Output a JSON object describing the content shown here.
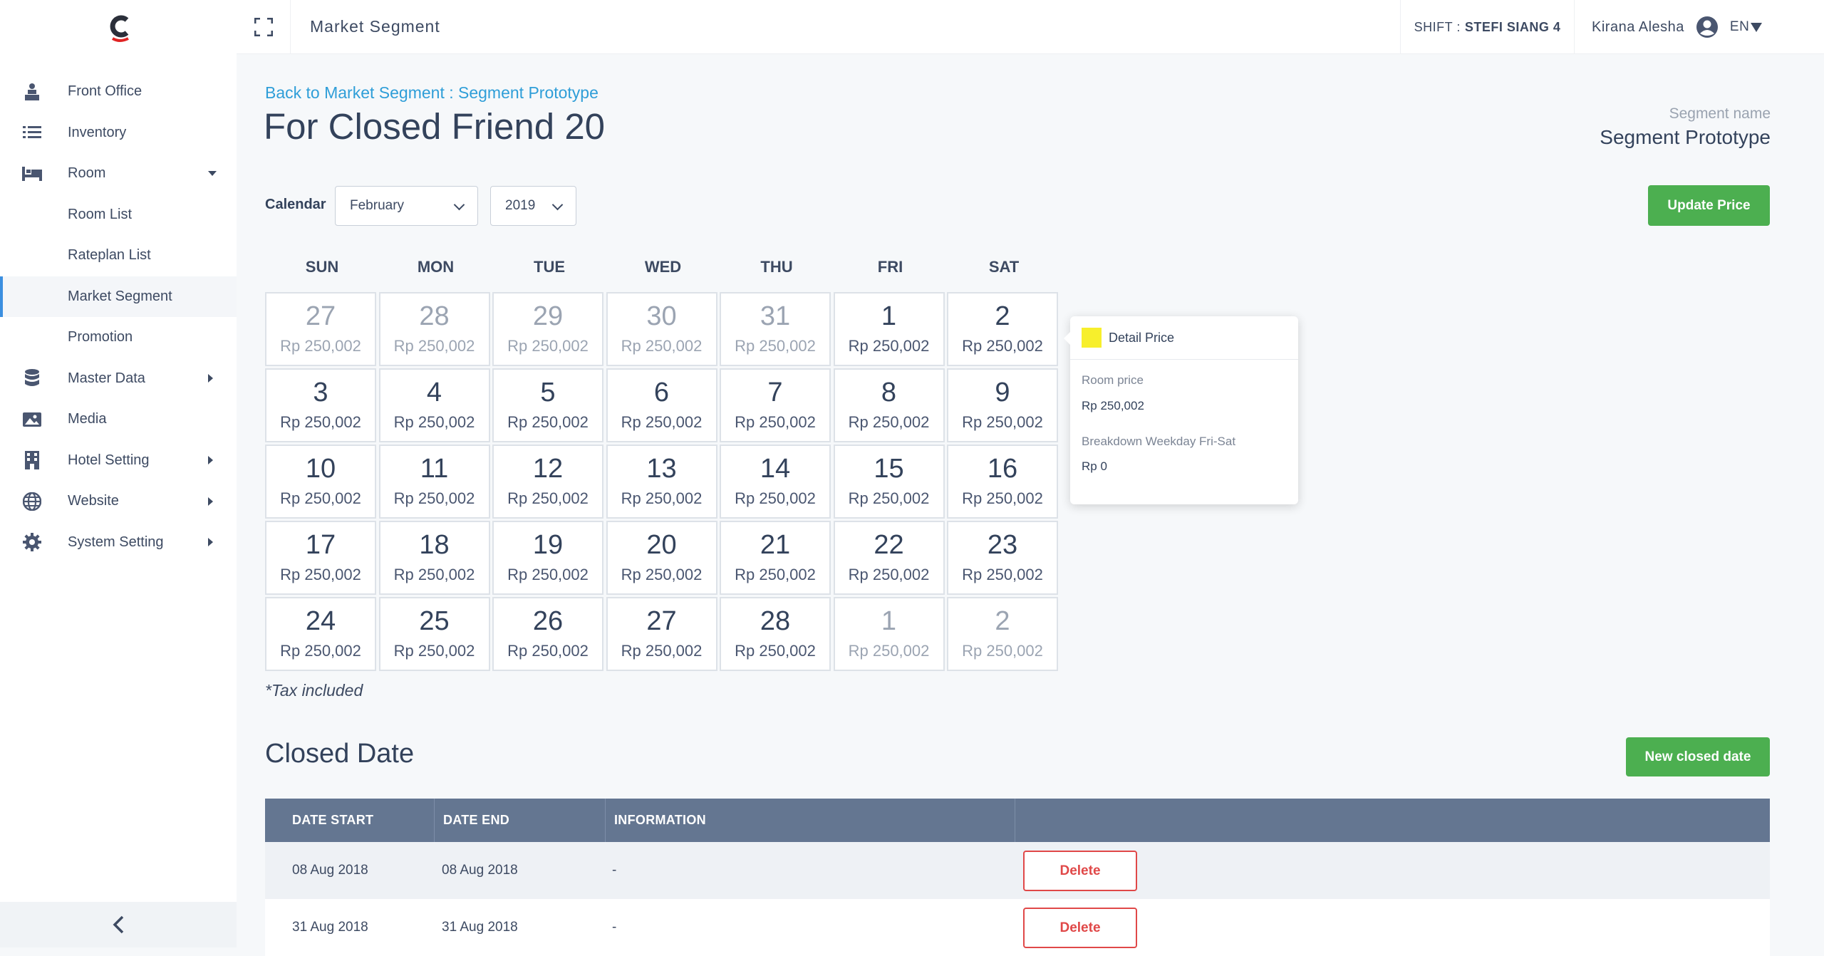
{
  "header": {
    "title": "Market Segment",
    "shift_label": "SHIFT :",
    "shift_name": "STEFI SIANG 4",
    "user_name": "Kirana Alesha",
    "language": "EN"
  },
  "sidebar": {
    "items": [
      {
        "label": "Front Office",
        "icon": "front-office-icon"
      },
      {
        "label": "Inventory",
        "icon": "list-icon"
      },
      {
        "label": "Room",
        "icon": "bed-icon",
        "expanded": true
      },
      {
        "label": "Room List"
      },
      {
        "label": "Rateplan List"
      },
      {
        "label": "Market Segment",
        "active": true
      },
      {
        "label": "Promotion"
      },
      {
        "label": "Master Data",
        "icon": "database-icon"
      },
      {
        "label": "Media",
        "icon": "image-icon"
      },
      {
        "label": "Hotel Setting",
        "icon": "building-icon"
      },
      {
        "label": "Website",
        "icon": "globe-icon"
      },
      {
        "label": "System Setting",
        "icon": "gear-icon"
      }
    ]
  },
  "page": {
    "back_link": "Back to Market Segment : Segment Prototype",
    "title": "For Closed Friend 20",
    "segment_name_label": "Segment name",
    "segment_name_value": "Segment Prototype",
    "update_button": "Update Price",
    "calendar_label": "Calendar",
    "month": "February",
    "year": "2019",
    "tax_note": "*Tax included"
  },
  "calendar": {
    "days": [
      "SUN",
      "MON",
      "TUE",
      "WED",
      "THU",
      "FRI",
      "SAT"
    ],
    "weeks": [
      [
        {
          "d": "27",
          "p": "Rp 250,002",
          "m": true
        },
        {
          "d": "28",
          "p": "Rp 250,002",
          "m": true
        },
        {
          "d": "29",
          "p": "Rp 250,002",
          "m": true
        },
        {
          "d": "30",
          "p": "Rp 250,002",
          "m": true
        },
        {
          "d": "31",
          "p": "Rp 250,002",
          "m": true
        },
        {
          "d": "1",
          "p": "Rp 250,002"
        },
        {
          "d": "2",
          "p": "Rp 250,002"
        }
      ],
      [
        {
          "d": "3",
          "p": "Rp 250,002"
        },
        {
          "d": "4",
          "p": "Rp 250,002"
        },
        {
          "d": "5",
          "p": "Rp 250,002"
        },
        {
          "d": "6",
          "p": "Rp 250,002"
        },
        {
          "d": "7",
          "p": "Rp 250,002"
        },
        {
          "d": "8",
          "p": "Rp 250,002"
        },
        {
          "d": "9",
          "p": "Rp 250,002"
        }
      ],
      [
        {
          "d": "10",
          "p": "Rp 250,002"
        },
        {
          "d": "11",
          "p": "Rp 250,002"
        },
        {
          "d": "12",
          "p": "Rp 250,002"
        },
        {
          "d": "13",
          "p": "Rp 250,002"
        },
        {
          "d": "14",
          "p": "Rp 250,002"
        },
        {
          "d": "15",
          "p": "Rp 250,002"
        },
        {
          "d": "16",
          "p": "Rp 250,002"
        }
      ],
      [
        {
          "d": "17",
          "p": "Rp 250,002"
        },
        {
          "d": "18",
          "p": "Rp 250,002"
        },
        {
          "d": "19",
          "p": "Rp 250,002"
        },
        {
          "d": "20",
          "p": "Rp 250,002"
        },
        {
          "d": "21",
          "p": "Rp 250,002"
        },
        {
          "d": "22",
          "p": "Rp 250,002"
        },
        {
          "d": "23",
          "p": "Rp 250,002"
        }
      ],
      [
        {
          "d": "24",
          "p": "Rp 250,002"
        },
        {
          "d": "25",
          "p": "Rp 250,002"
        },
        {
          "d": "26",
          "p": "Rp 250,002"
        },
        {
          "d": "27",
          "p": "Rp 250,002"
        },
        {
          "d": "28",
          "p": "Rp 250,002"
        },
        {
          "d": "1",
          "p": "Rp 250,002",
          "m": true
        },
        {
          "d": "2",
          "p": "Rp 250,002",
          "m": true
        }
      ]
    ]
  },
  "popover": {
    "title": "Detail Price",
    "swatch_color": "#f7ef2c",
    "room_price_label": "Room price",
    "room_price_value": "Rp 250,002",
    "breakdown_label": "Breakdown Weekday Fri-Sat",
    "breakdown_value": "Rp 0"
  },
  "closed": {
    "title": "Closed Date",
    "new_button": "New closed date",
    "columns": [
      "DATE START",
      "DATE END",
      "INFORMATION"
    ],
    "rows": [
      {
        "start": "08 Aug 2018",
        "end": "08 Aug 2018",
        "info": "-",
        "action": "Delete"
      },
      {
        "start": "31 Aug 2018",
        "end": "31 Aug 2018",
        "info": "-",
        "action": "Delete"
      }
    ]
  },
  "colors": {
    "accent_green": "#4caf50",
    "link_blue": "#2f9ed8",
    "table_header": "#647691",
    "delete_red": "#e04848"
  }
}
